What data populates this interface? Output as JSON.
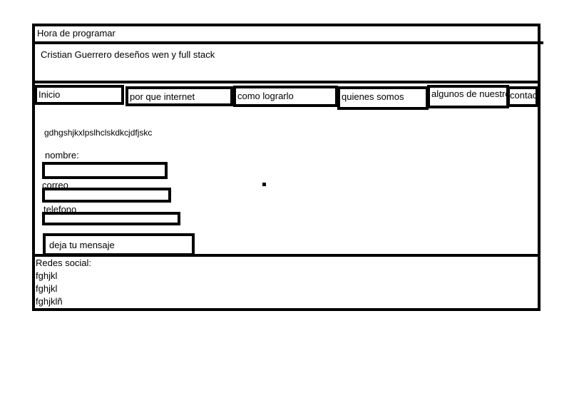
{
  "header": {
    "title": "Hora de programar",
    "subtitle": "Cristian Guerrero deseños wen y full stack"
  },
  "nav": {
    "items": [
      {
        "label": "Inicio"
      },
      {
        "label": "por que internet"
      },
      {
        "label": "como lograrlo"
      },
      {
        "label": "quienes somos"
      },
      {
        "label": "algunos de nuestros"
      },
      {
        "label": "contacto"
      }
    ]
  },
  "main": {
    "intro_text": "gdhgshjkxlpslhclskdkcjdfjskc",
    "form": {
      "nombre_label": "nombre:",
      "correo_label": "correo",
      "telefono_label": "telefono",
      "message_button": "deja tu mensaje"
    }
  },
  "footer": {
    "heading": "Redes social:",
    "links": [
      {
        "label": "fghjkl"
      },
      {
        "label": "fghjkl"
      },
      {
        "label": "fghjklñ"
      }
    ]
  }
}
